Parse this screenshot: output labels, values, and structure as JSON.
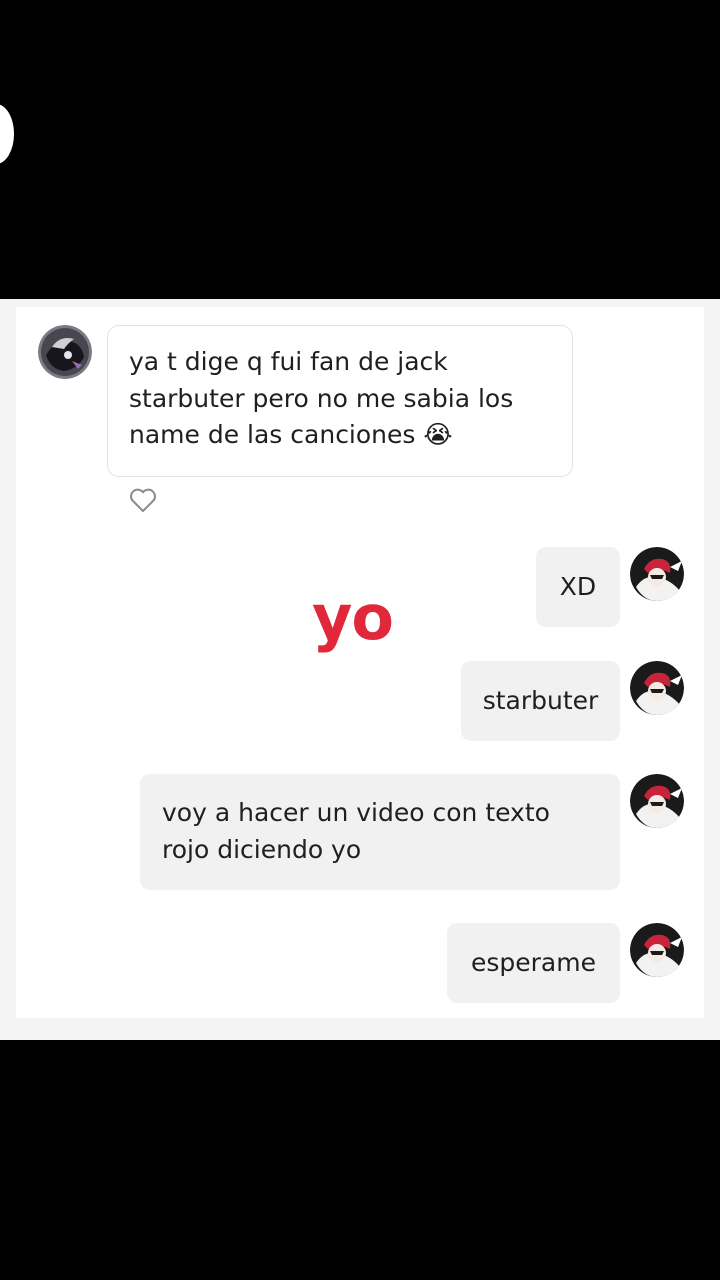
{
  "incoming": {
    "message": "ya t dige q fui fan de jack starbuter pero no me sabia los name de las canciones",
    "emoji": "😭"
  },
  "overlay": {
    "text": "yo",
    "color": "#e0283a"
  },
  "outgoing": [
    {
      "text": "XD"
    },
    {
      "text": "starbuter"
    },
    {
      "text": "voy a hacer un video con texto rojo diciendo yo"
    },
    {
      "text": "esperame"
    }
  ],
  "icons": {
    "like": "heart-outline-icon",
    "sender_avatar": "dark-character-avatar",
    "self_avatar": "red-hair-character-avatar"
  },
  "colors": {
    "background": "#000000",
    "panel": "#f4f4f5",
    "outgoing_bubble": "#f1f1f2",
    "overlay_red": "#e0283a"
  }
}
